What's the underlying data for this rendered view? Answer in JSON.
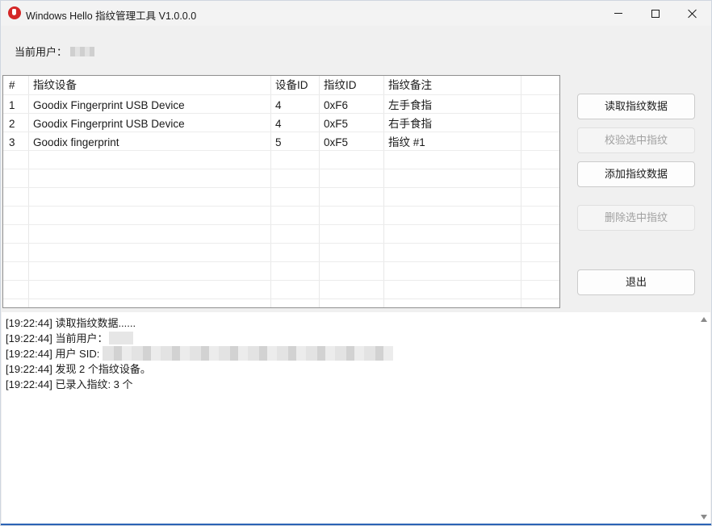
{
  "window": {
    "title": "Windows Hello 指纹管理工具 V1.0.0.0"
  },
  "user": {
    "label": "当前用户："
  },
  "table": {
    "headers": [
      "#",
      "指纹设备",
      "设备ID",
      "指纹ID",
      "指纹备注"
    ],
    "rows": [
      [
        "1",
        "Goodix Fingerprint USB Device",
        "4",
        "0xF6",
        "左手食指"
      ],
      [
        "2",
        "Goodix Fingerprint USB Device",
        "4",
        "0xF5",
        "右手食指"
      ],
      [
        "3",
        "Goodix fingerprint",
        "5",
        "0xF5",
        "指纹 #1"
      ]
    ]
  },
  "buttons": {
    "read": "读取指纹数据",
    "verify": "校验选中指纹",
    "add": "添加指纹数据",
    "delete": "删除选中指纹",
    "exit": "退出"
  },
  "log": [
    "[19:22:44] 读取指纹数据......",
    "[19:22:44] 当前用户：",
    "[19:22:44] 用户 SID:",
    "[19:22:44] 发现 2 个指纹设备。",
    "[19:22:44] 已录入指纹: 3 个"
  ],
  "icons": {
    "app": "hand-stop-icon",
    "minimize": "minimize-icon",
    "maximize": "maximize-icon",
    "close": "close-icon"
  }
}
